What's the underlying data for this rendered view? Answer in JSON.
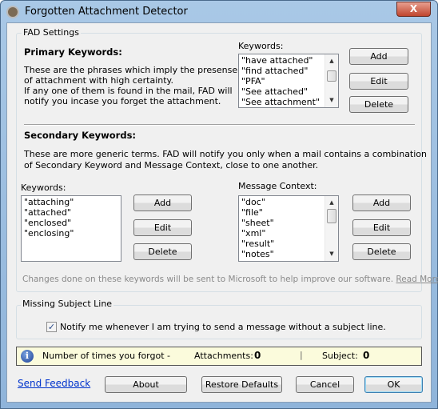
{
  "window": {
    "title": "Forgotten Attachment Detector",
    "close_label": "X"
  },
  "fad_settings": {
    "group_label": "FAD Settings",
    "primary": {
      "heading": "Primary Keywords:",
      "description": [
        "These are the phrases which imply the presense",
        "of attachment with high certainty.",
        "If any one of them is found in the mail, FAD will",
        "notify you incase you forget the attachment."
      ],
      "keywords_label": "Keywords:",
      "keywords": [
        "\"have attached\"",
        "\"find attached\"",
        "\"PFA\"",
        "\"See attached\"",
        "\"See attachment\""
      ],
      "add": "Add",
      "edit": "Edit",
      "delete": "Delete"
    },
    "secondary": {
      "heading": "Secondary Keywords:",
      "description": [
        "These are more generic terms. FAD will notify you only when a mail contains a combination",
        "of Secondary Keyword and Message Context, close to one another."
      ],
      "keywords_label": "Keywords:",
      "keywords": [
        "\"attaching\"",
        "\"attached\"",
        "\"enclosed\"",
        "\"enclosing\""
      ],
      "context_label": "Message Context:",
      "context": [
        "\"doc\"",
        "\"file\"",
        "\"sheet\"",
        "\"xml\"",
        "\"result\"",
        "\"notes\""
      ],
      "add": "Add",
      "edit": "Edit",
      "delete": "Delete"
    },
    "notice": "Changes done on these keywords will be sent to Microsoft to help improve our software.",
    "read_more": "Read More"
  },
  "missing_subject": {
    "group_label": "Missing Subject Line",
    "checkbox_label": "Notify me whenever I am trying to send a message without a subject line.",
    "checked": true
  },
  "info_bar": {
    "text": "Number of times you forgot -",
    "attachments_label": "Attachments:",
    "attachments_value": "0",
    "separator": "|",
    "subject_label": "Subject:",
    "subject_value": "0",
    "background": "#fbfbdc"
  },
  "footer": {
    "send_feedback": "Send Feedback",
    "about": "About",
    "restore_defaults": "Restore Defaults",
    "cancel": "Cancel",
    "ok": "OK"
  }
}
